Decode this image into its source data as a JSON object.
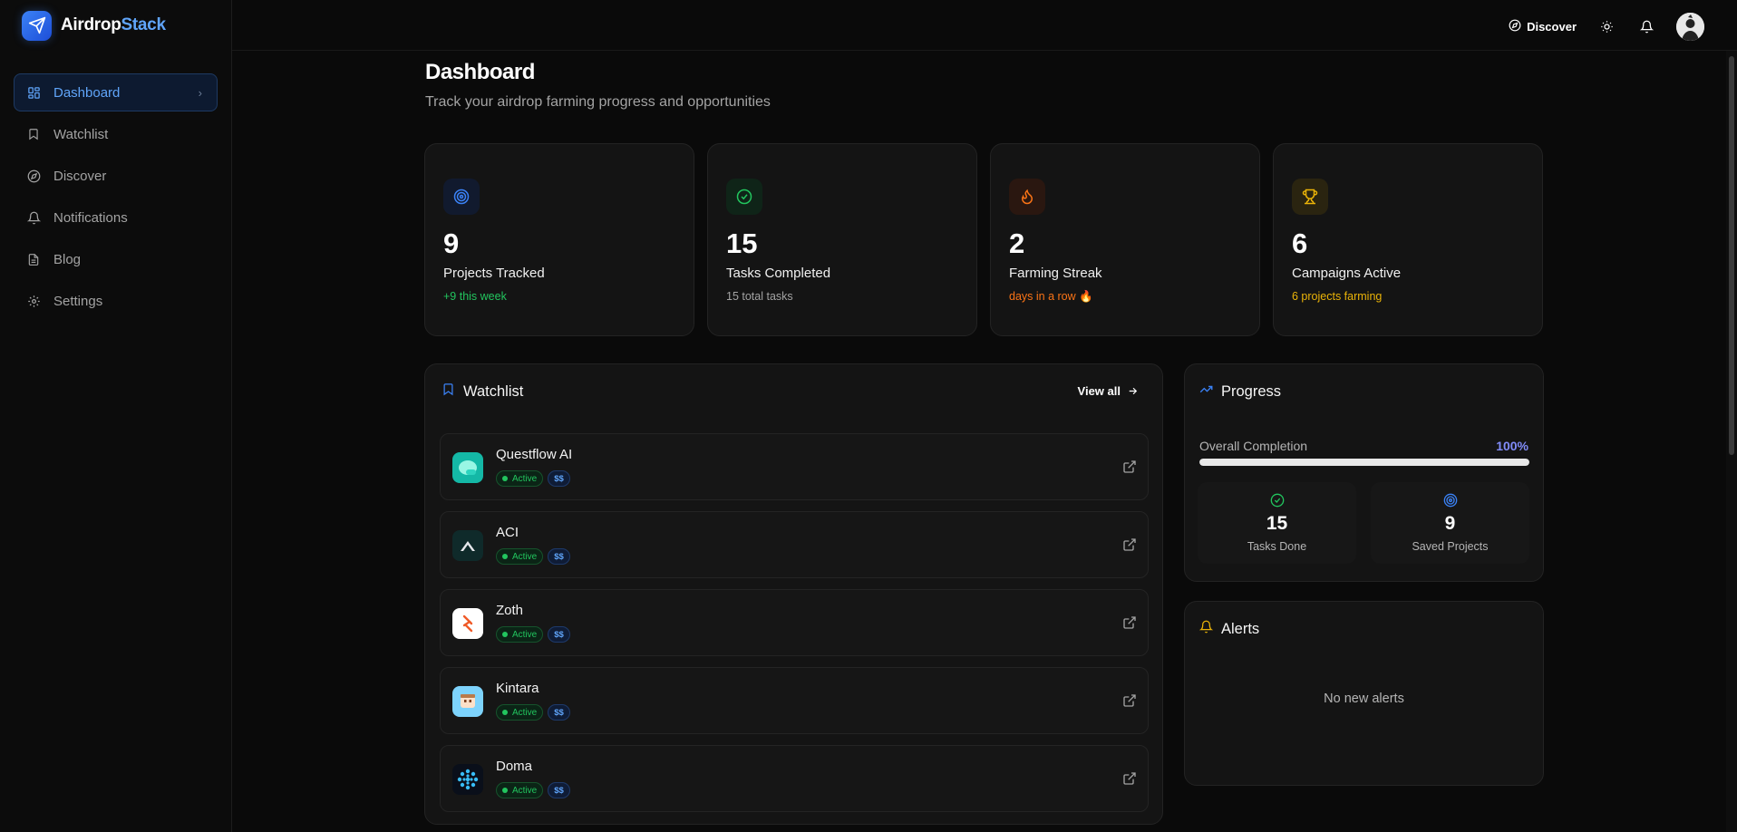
{
  "brand": {
    "name_part1": "Airdrop",
    "name_part2": "Stack"
  },
  "sidebar": {
    "items": [
      {
        "label": "Dashboard",
        "icon": "grid-icon",
        "active": true
      },
      {
        "label": "Watchlist",
        "icon": "bookmark-icon"
      },
      {
        "label": "Discover",
        "icon": "compass-icon"
      },
      {
        "label": "Notifications",
        "icon": "bell-icon"
      },
      {
        "label": "Blog",
        "icon": "document-icon"
      },
      {
        "label": "Settings",
        "icon": "gear-icon"
      }
    ]
  },
  "header": {
    "discover_label": "Discover"
  },
  "page": {
    "title": "Dashboard",
    "subtitle": "Track your airdrop farming progress and opportunities"
  },
  "stats": [
    {
      "value": "9",
      "label": "Projects Tracked",
      "sub": "+9 this week",
      "sub_color": "#22c55e",
      "icon": "target-icon",
      "accent": "#3b82f6"
    },
    {
      "value": "15",
      "label": "Tasks Completed",
      "sub": "15 total tasks",
      "sub_color": "#a3a3a3",
      "icon": "check-circle-icon",
      "accent": "#22c55e"
    },
    {
      "value": "2",
      "label": "Farming Streak",
      "sub": "days in a row 🔥",
      "sub_color": "#f97316",
      "icon": "flame-icon",
      "accent": "#f97316"
    },
    {
      "value": "6",
      "label": "Campaigns Active",
      "sub": "6 projects farming",
      "sub_color": "#eab308",
      "icon": "trophy-icon",
      "accent": "#eab308"
    }
  ],
  "watchlist": {
    "title": "Watchlist",
    "view_all": "View all",
    "items": [
      {
        "name": "Questflow AI",
        "status": "Active",
        "cost": "$$"
      },
      {
        "name": "ACI",
        "status": "Active",
        "cost": "$$"
      },
      {
        "name": "Zoth",
        "status": "Active",
        "cost": "$$"
      },
      {
        "name": "Kintara",
        "status": "Active",
        "cost": "$$"
      },
      {
        "name": "Doma",
        "status": "Active",
        "cost": "$$"
      }
    ]
  },
  "progress": {
    "title": "Progress",
    "overall_label": "Overall Completion",
    "overall_pct": "100%",
    "overall_fraction": 1.0,
    "tasks_done_value": "15",
    "tasks_done_label": "Tasks Done",
    "saved_value": "9",
    "saved_label": "Saved Projects"
  },
  "alerts": {
    "title": "Alerts",
    "empty": "No new alerts"
  }
}
